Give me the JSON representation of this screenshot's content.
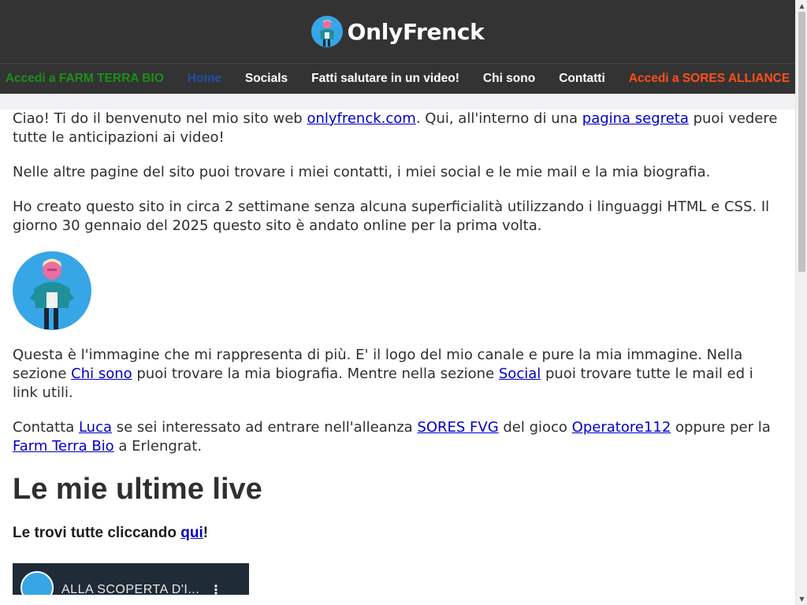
{
  "brand": {
    "name": "OnlyFrenck",
    "logo_icon": "onlyfrenck-logo-icon"
  },
  "nav": {
    "items": [
      {
        "label": "Accedi a FARM TERRA BIO",
        "color": "#1a8f1a"
      },
      {
        "label": "Home",
        "color": "#1e4fa8"
      },
      {
        "label": "Socials",
        "color": "#ffffff"
      },
      {
        "label": "Fatti salutare in un video!",
        "color": "#ffffff"
      },
      {
        "label": "Chi sono",
        "color": "#ffffff"
      },
      {
        "label": "Contatti",
        "color": "#ffffff"
      },
      {
        "label": "Accedi a SORES ALLIANCE",
        "color": "#ff4f1a"
      }
    ]
  },
  "content": {
    "p1": {
      "t1": "Ciao! Ti do il benvenuto nel mio sito web ",
      "link1": "onlyfrenck.com",
      "t2": ". Qui, all'interno di una ",
      "link2": "pagina segreta",
      "t3": " puoi vedere tutte le anticipazioni ai video!"
    },
    "p2": "Nelle altre pagine del sito puoi trovare i miei contatti, i miei social e le mie mail e la mia biografia.",
    "p3": "Ho creato questo sito in circa 2 settimane senza alcuna superficialità utilizzando i linguaggi HTML e CSS. Il giorno 30 gennaio del 2025 questo sito è andato online per la prima volta.",
    "avatar_icon": "onlyfrenck-avatar-image",
    "p4": {
      "t1": "Questa è l'immagine che mi rappresenta di più. E' il logo del mio canale e pure la mia immagine. Nella sezione ",
      "link1": "Chi sono",
      "t2": " puoi trovare la mia biografia. Mentre nella sezione ",
      "link2": "Social",
      "t3": " puoi trovare tutte le mail ed i link utili."
    },
    "p5": {
      "t1": "Contatta ",
      "link1": "Luca",
      "t2": " se sei interessato ad entrare nell'alleanza ",
      "link2": "SORES FVG",
      "t3": " del gioco ",
      "link3": "Operatore112",
      "t4": " oppure per la ",
      "link4": "Farm Terra Bio",
      "t5": " a Erlengrat."
    },
    "section_title": "Le mie ultime live",
    "sub": {
      "t1": "Le trovi tutte cliccando ",
      "link": "qui",
      "t2": "!"
    },
    "video": {
      "title": "ALLA SCOPERTA D'I...",
      "menu_icon": "more-vert-icon"
    }
  },
  "colors": {
    "header_bg": "#333333",
    "link": "#0000c4",
    "text": "#2f2f2f"
  }
}
